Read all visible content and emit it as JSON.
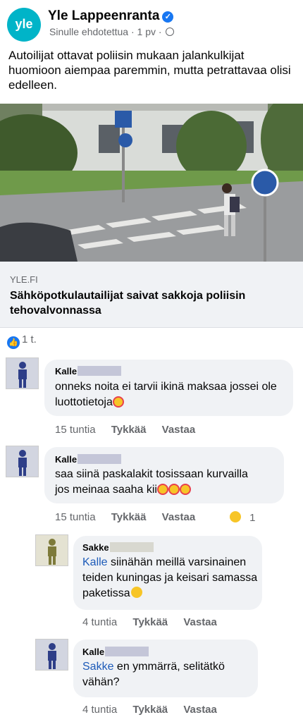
{
  "header": {
    "logo_text": "yle",
    "page_name": "Yle Lappeenranta",
    "suggested": "Sinulle ehdotettua",
    "time": "1 pv"
  },
  "post": {
    "text": "Autoilijat ottavat poliisin mukaan jalankulkijat huomioon aiempaa paremmin, mutta petrattavaa olisi edelleen."
  },
  "link": {
    "domain": "YLE.FI",
    "title": "Sähköpotkulautailijat saivat sakkoja poliisin tehovalvonnassa"
  },
  "reactions": {
    "count": "1 t."
  },
  "comments": [
    {
      "author": "Kalle",
      "text": "onneks noita ei tarvii ikinä maksaa jossei ole luottotietoja",
      "time": "15 tuntia",
      "like": "Tykkää",
      "reply": "Vastaa"
    },
    {
      "author": "Kalle",
      "text_line1": "saa siinä paskalakit tosissaan kurvailla",
      "text_line2": "jos meinaa saaha kii",
      "time": "15 tuntia",
      "like": "Tykkää",
      "reply": "Vastaa",
      "reaction_count": "1"
    },
    {
      "author": "Sakke",
      "mention": "Kalle",
      "text": " siinähän meillä varsinainen teiden kuningas ja keisari samassa paketissa",
      "time": "4 tuntia",
      "like": "Tykkää",
      "reply": "Vastaa"
    },
    {
      "author": "Kalle",
      "mention": "Sakke",
      "text": " en ymmärrä, selitätkö vähän?",
      "time": "4 tuntia",
      "like": "Tykkää",
      "reply": "Vastaa"
    }
  ],
  "colors": {
    "accent": "#1877f2",
    "mention": "#1c5ab8",
    "bubble": "#f0f2f5",
    "meta": "#65676b"
  }
}
